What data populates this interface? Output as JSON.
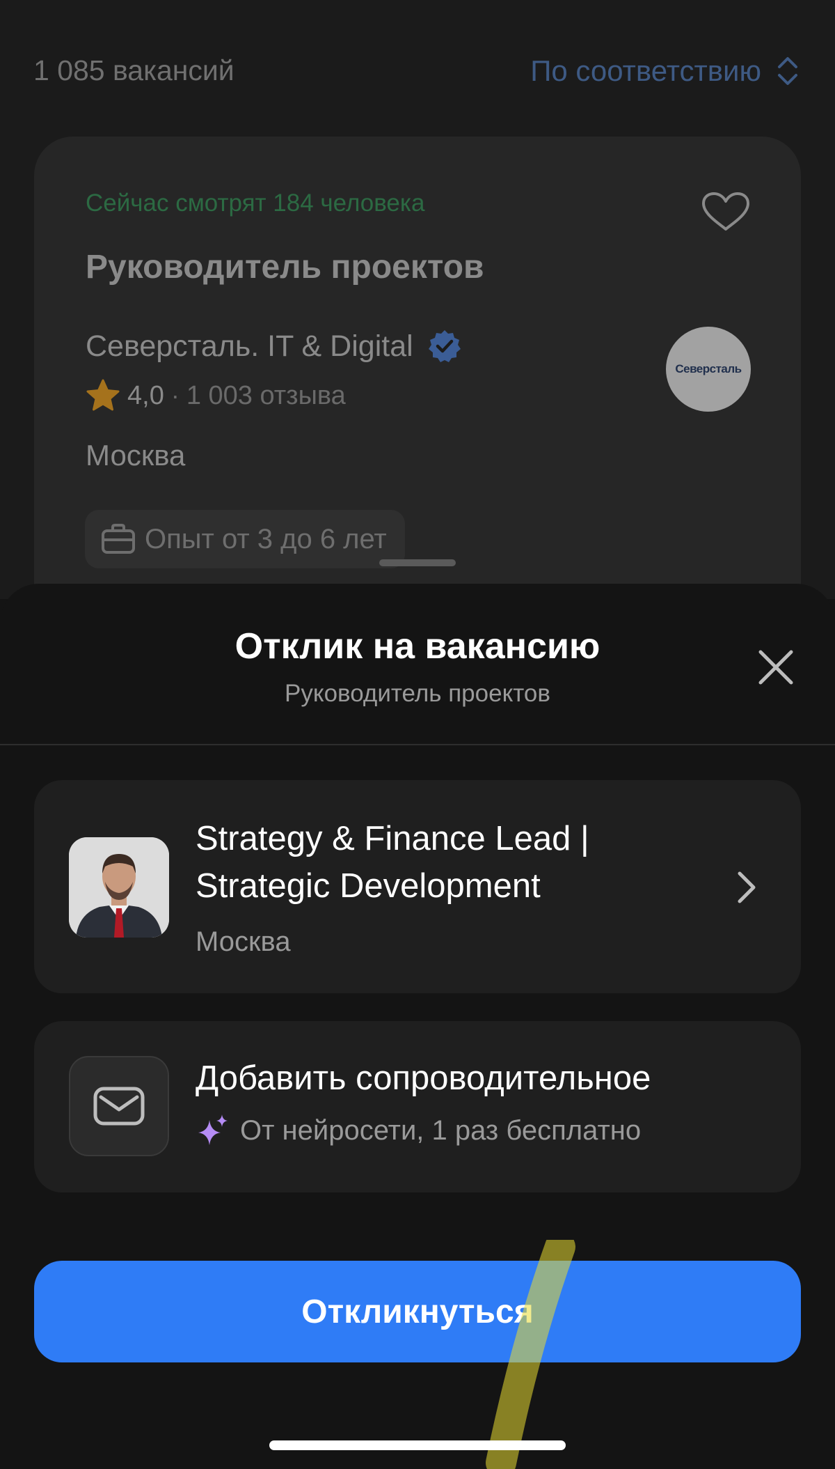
{
  "list": {
    "count": "1 085 вакансий",
    "sort_label": "По соответствию"
  },
  "vacancy": {
    "watching": "Сейчас смотрят 184 человека",
    "title": "Руководитель проектов",
    "company": "Северсталь. IT & Digital",
    "rating": "4,0",
    "reviews": "1 003 отзыва",
    "city": "Москва",
    "experience": "Опыт от 3 до 6 лет",
    "logo_text": "Северсталь"
  },
  "sheet": {
    "title": "Отклик на вакансию",
    "subtitle": "Руководитель проектов",
    "resume": {
      "title": "Strategy & Finance Lead | Strategic Development",
      "city": "Москва"
    },
    "cover_letter": {
      "title": "Добавить сопроводительное",
      "subtitle": "От нейросети, 1 раз бесплатно"
    },
    "apply_label": "Откликнуться"
  },
  "colors": {
    "accent_blue": "#2f7cf6",
    "watching_green": "#2c6a43",
    "sort_blue": "#3e5a84",
    "ai_sparkle": "#b58cf5"
  }
}
